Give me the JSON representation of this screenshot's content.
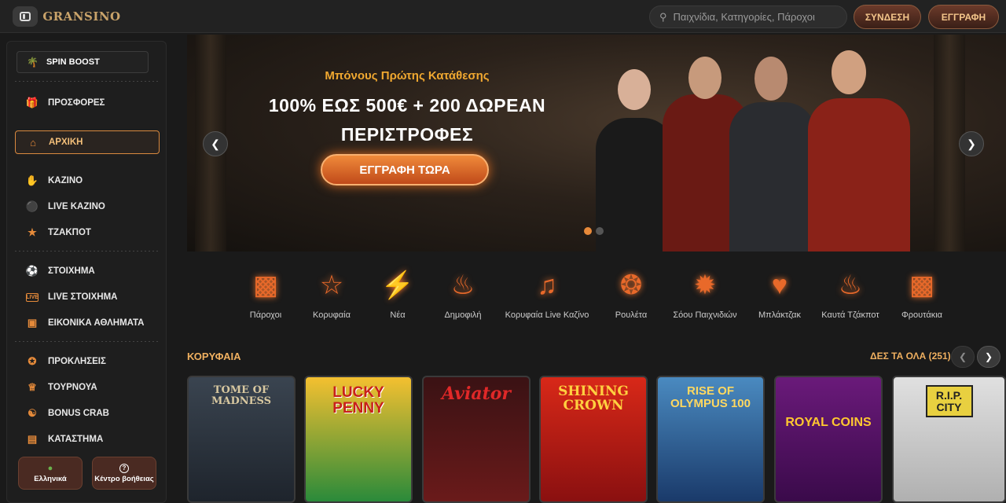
{
  "header": {
    "logo": "GRANSINO",
    "search_placeholder": "Παιχνίδια, Κατηγορίες, Πάροχοι",
    "login_label": "ΣΥΝΔΕΣΗ",
    "register_label": "ΕΓΓΡΑΦΗ"
  },
  "sidebar": {
    "spin_boost": "SPIN BOOST",
    "items": [
      {
        "label": "ΠΡΟΣΦΟΡΕΣ",
        "icon": "gift-icon"
      },
      {
        "label": "ΑΡΧΙΚΗ",
        "icon": "home-icon",
        "active": true
      },
      {
        "label": "ΚΑΖΙΝΟ",
        "icon": "rock-hand-icon"
      },
      {
        "label": "LIVE ΚΑΖΙΝΟ",
        "icon": "microphone-icon"
      },
      {
        "label": "ΤΖΑΚΠΟΤ",
        "icon": "jackpot-icon"
      },
      {
        "label": "ΣΤΟΙΧΗΜΑ",
        "icon": "basketball-icon"
      },
      {
        "label": "LIVE ΣΤΟΙΧΗΜΑ",
        "icon": "live-icon"
      },
      {
        "label": "ΕΙΚΟΝΙΚΑ ΑΘΛΗΜΑΤΑ",
        "icon": "monitor-icon"
      },
      {
        "label": "ΠΡΟΚΛΗΣΕΙΣ",
        "icon": "medal-icon"
      },
      {
        "label": "ΤΟΥΡΝΟΥΑ",
        "icon": "trophy-icon"
      },
      {
        "label": "BONUS CRAB",
        "icon": "crab-icon"
      },
      {
        "label": "ΚΑΤΑΣΤΗΜΑ",
        "icon": "store-icon"
      }
    ],
    "language_label": "Ελληνικά",
    "help_label": "Κέντρο βοήθειας"
  },
  "banner": {
    "subtitle": "Μπόνους Πρώτης Κατάθεσης",
    "title_line1": "100% ΕΩΣ 500€ + 200 ΔΩΡΕΑΝ",
    "title_line2": "ΠΕΡΙΣΤΡΟΦΕΣ",
    "cta": "ΕΓΓΡΑΦΗ ΤΩΡΑ"
  },
  "categories": [
    {
      "label": "Πάροχοι",
      "icon": "slot-machine-icon"
    },
    {
      "label": "Κορυφαία",
      "icon": "star-icon"
    },
    {
      "label": "Νέα",
      "icon": "lightning-icon"
    },
    {
      "label": "Δημοφιλή",
      "icon": "flame-icon"
    },
    {
      "label": "Κορυφαία Live Καζίνο",
      "icon": "microphone-icon"
    },
    {
      "label": "Ρουλέτα",
      "icon": "roulette-icon"
    },
    {
      "label": "Σόου Παιχνιδιών",
      "icon": "wheel-icon"
    },
    {
      "label": "Μπλάκτζακ",
      "icon": "cards-icon"
    },
    {
      "label": "Καυτά Τζάκποτ",
      "icon": "hot-icon"
    },
    {
      "label": "Φρουτάκια",
      "icon": "fruit-slot-icon"
    }
  ],
  "section": {
    "title": "ΚΟΡΥΦΑΙΑ",
    "see_all": "ΔΕΣ ΤΑ ΟΛΑ (251)"
  },
  "games": [
    {
      "title": "TOME OF MADNESS",
      "bg": "#2e3540",
      "color": "#d8c8a0"
    },
    {
      "title": "LUCKY PENNY",
      "bg": "#e8a020",
      "color": "#c8201a"
    },
    {
      "title": "Aviator",
      "bg": "#3a1214",
      "color": "#e02828"
    },
    {
      "title": "SHINING CROWN",
      "bg": "#c82018",
      "color": "#ffd040"
    },
    {
      "title": "RISE OF OLYMPUS 100",
      "bg": "#2a5a8a",
      "color": "#ffd860"
    },
    {
      "title": "ROYAL COINS",
      "bg": "#5a1a6a",
      "color": "#ffc830"
    },
    {
      "title": "R.I.P. CITY",
      "bg": "#d8d8d8",
      "color": "#222"
    }
  ]
}
